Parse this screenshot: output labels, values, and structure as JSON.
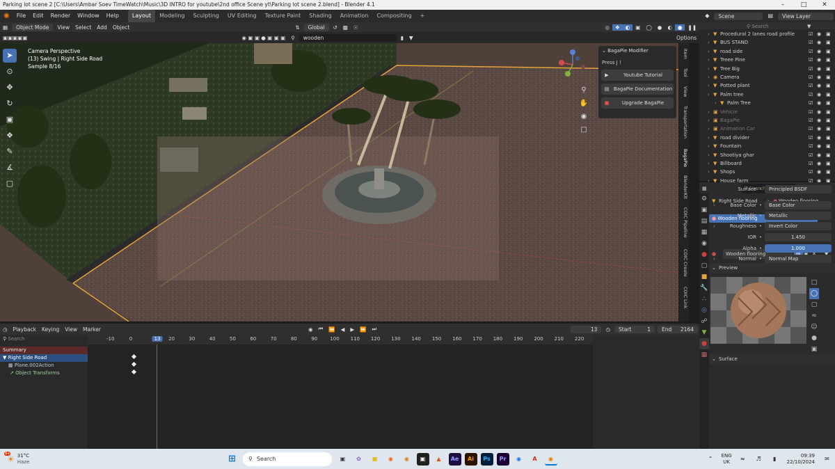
{
  "window": {
    "title": "Parking lot scene 2 [C:\\Users\\Ambar Soev TimeWatch\\Music\\3D INTRO for youtube\\2nd office Scene yt\\Parking lot scene 2.blend] - Blender 4.1"
  },
  "menu": {
    "items": [
      "File",
      "Edit",
      "Render",
      "Window",
      "Help"
    ],
    "workspaces": [
      "Layout",
      "Modeling",
      "Sculpting",
      "UV Editing",
      "Texture Paint",
      "Shading",
      "Animation",
      "Compositing"
    ],
    "active_workspace": "Layout",
    "scene_label": "Scene",
    "view_layer_label": "View Layer"
  },
  "viewport_header": {
    "mode": "Object Mode",
    "menus": [
      "View",
      "Select",
      "Add",
      "Object"
    ],
    "orientation": "Global",
    "search_value": "wooden",
    "options_label": "Options"
  },
  "viewport_overlay": {
    "line1": "Camera Perspective",
    "line2": "(13) Swing | Right Side Road",
    "line3": "Sample 8/16"
  },
  "bagapie": {
    "title": "BagaPie Modifier",
    "hint": "Press J !",
    "buttons": [
      "Youtube Tutorial",
      "BagaPie Documentation",
      "Upgrade BagaPie"
    ]
  },
  "side_tabs": [
    "Item",
    "Tool",
    "View",
    "Transportation",
    "BagaPie",
    "BlenderKit",
    "COIC Pipeline",
    "COIC Create",
    "COIC Link"
  ],
  "timeline": {
    "menus": [
      "Playback",
      "Keying",
      "View",
      "Marker"
    ],
    "current_frame": "13",
    "start_label": "Start",
    "start": "1",
    "end_label": "End",
    "end": "2164",
    "search_placeholder": "Search",
    "channels": [
      "Summary",
      "Right Side Road",
      "Plane.002Action",
      "Object Transforms"
    ],
    "ruler": [
      "-10",
      "0",
      "13",
      "20",
      "30",
      "40",
      "50",
      "60",
      "70",
      "80",
      "90",
      "100",
      "110",
      "120",
      "130",
      "140",
      "150",
      "160",
      "170",
      "180",
      "190",
      "200",
      "210",
      "220"
    ]
  },
  "outliner": {
    "search_placeholder": "Search",
    "rows": [
      {
        "name": "Procedural 2 lanes road profile"
      },
      {
        "name": "BUS STAND"
      },
      {
        "name": "road side"
      },
      {
        "name": "Treee Pine"
      },
      {
        "name": "Tree Big"
      },
      {
        "name": "Camera"
      },
      {
        "name": "Potted plant"
      },
      {
        "name": "Palm tree"
      },
      {
        "name": "Palm Tree"
      },
      {
        "name": "Vehicle"
      },
      {
        "name": "BagaPie"
      },
      {
        "name": "Animation Car"
      },
      {
        "name": "road divider"
      },
      {
        "name": "Fountain"
      },
      {
        "name": "Shootiya ghar"
      },
      {
        "name": "Billboard"
      },
      {
        "name": "Shops"
      },
      {
        "name": "House farm"
      }
    ]
  },
  "properties": {
    "search_placeholder": "Search",
    "breadcrumb_object": "Right Side Road",
    "breadcrumb_material": "Wooden flooring",
    "slot_name": "Wooden flooring",
    "material_name": "Wooden flooring",
    "preview_label": "Preview",
    "surface_label": "Surface",
    "fields": [
      {
        "label": "Surface",
        "value": "Principled BSDF"
      },
      {
        "label": "Base Color",
        "value": "Base Color"
      },
      {
        "label": "Metallic",
        "value": "Metallic"
      },
      {
        "label": "Roughness",
        "value": "Invert Color"
      },
      {
        "label": "IOR",
        "value": "1.450"
      },
      {
        "label": "Alpha",
        "value": "1.000"
      },
      {
        "label": "Normal",
        "value": "Normal Map"
      }
    ]
  },
  "taskbar": {
    "weather_temp": "31°C",
    "weather_desc": "Haze",
    "weather_badge": "9+",
    "search_label": "Search",
    "apps": [
      "Ae",
      "Ai",
      "Ps",
      "Pr"
    ],
    "lang_line1": "ENG",
    "lang_line2": "UK",
    "time": "09:39",
    "date": "22/10/2024"
  },
  "colors": {
    "accent": "#4772b3",
    "selection_outline": "#e8a33a"
  }
}
